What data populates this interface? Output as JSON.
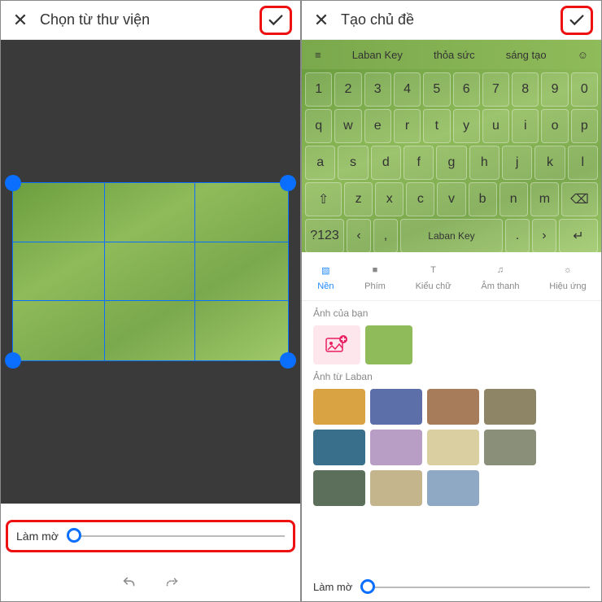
{
  "left": {
    "title": "Chọn từ thư viện",
    "blur_label": "Làm mờ"
  },
  "right": {
    "title": "Tạo chủ đề",
    "suggestions": [
      "Laban Key",
      "thỏa sức",
      "sáng tạo"
    ],
    "keyboard": {
      "row1": [
        "1",
        "2",
        "3",
        "4",
        "5",
        "6",
        "7",
        "8",
        "9",
        "0"
      ],
      "row2": [
        "q",
        "w",
        "e",
        "r",
        "t",
        "y",
        "u",
        "i",
        "o",
        "p"
      ],
      "row3": [
        "a",
        "s",
        "d",
        "f",
        "g",
        "h",
        "j",
        "k",
        "l"
      ],
      "row4": [
        "z",
        "x",
        "c",
        "v",
        "b",
        "n",
        "m"
      ],
      "space_label": "Laban Key",
      "sym_label": "?123"
    },
    "tabs": [
      {
        "label": "Nền",
        "active": true
      },
      {
        "label": "Phím",
        "active": false
      },
      {
        "label": "Kiểu chữ",
        "active": false
      },
      {
        "label": "Âm thanh",
        "active": false
      },
      {
        "label": "Hiệu ứng",
        "active": false
      }
    ],
    "section_user": "Ảnh của bạn",
    "section_laban": "Ảnh từ Laban",
    "blur_label": "Làm mờ",
    "laban_colors": [
      "#d9a344",
      "#5c6fa8",
      "#a77c5a",
      "#8d8565",
      "#3a6f8c",
      "#b89ec4",
      "#d9cfa0",
      "#8a8f7a",
      "#5c6f5a",
      "#c4b58c",
      "#8fa8c4"
    ]
  }
}
